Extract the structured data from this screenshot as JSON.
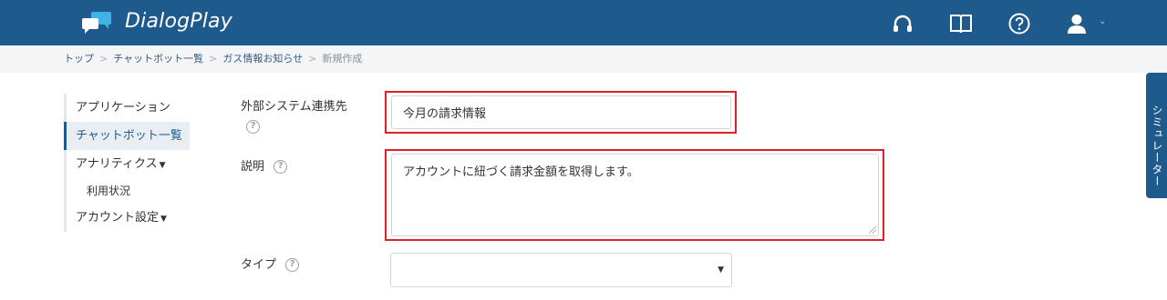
{
  "app": {
    "brand": "DialogPlay"
  },
  "topnav": {
    "icons": [
      "headset-icon",
      "book-icon",
      "help-circle-icon",
      "user-icon"
    ]
  },
  "breadcrumb": {
    "items": [
      "トップ",
      "チャットボット一覧",
      "ガス情報お知らせ"
    ],
    "current": "新規作成",
    "separator": ">"
  },
  "sidebar": {
    "items": [
      {
        "label": "アプリケーション"
      },
      {
        "label": "チャットボット一覧"
      },
      {
        "label": "アナリティクス"
      },
      {
        "label": "利用状況"
      },
      {
        "label": "アカウント設定"
      }
    ]
  },
  "form": {
    "external_system": {
      "label": "外部システム連携先",
      "value": "今月の請求情報"
    },
    "description": {
      "label": "説明",
      "value": "アカウントに紐づく請求金額を取得します。"
    },
    "type": {
      "label": "タイプ",
      "value": ""
    }
  },
  "simulator": {
    "label": "シミュレーター"
  },
  "colors": {
    "topbar": "#1e5a8c",
    "highlight": "#e0202a",
    "link": "#3a5a78"
  }
}
